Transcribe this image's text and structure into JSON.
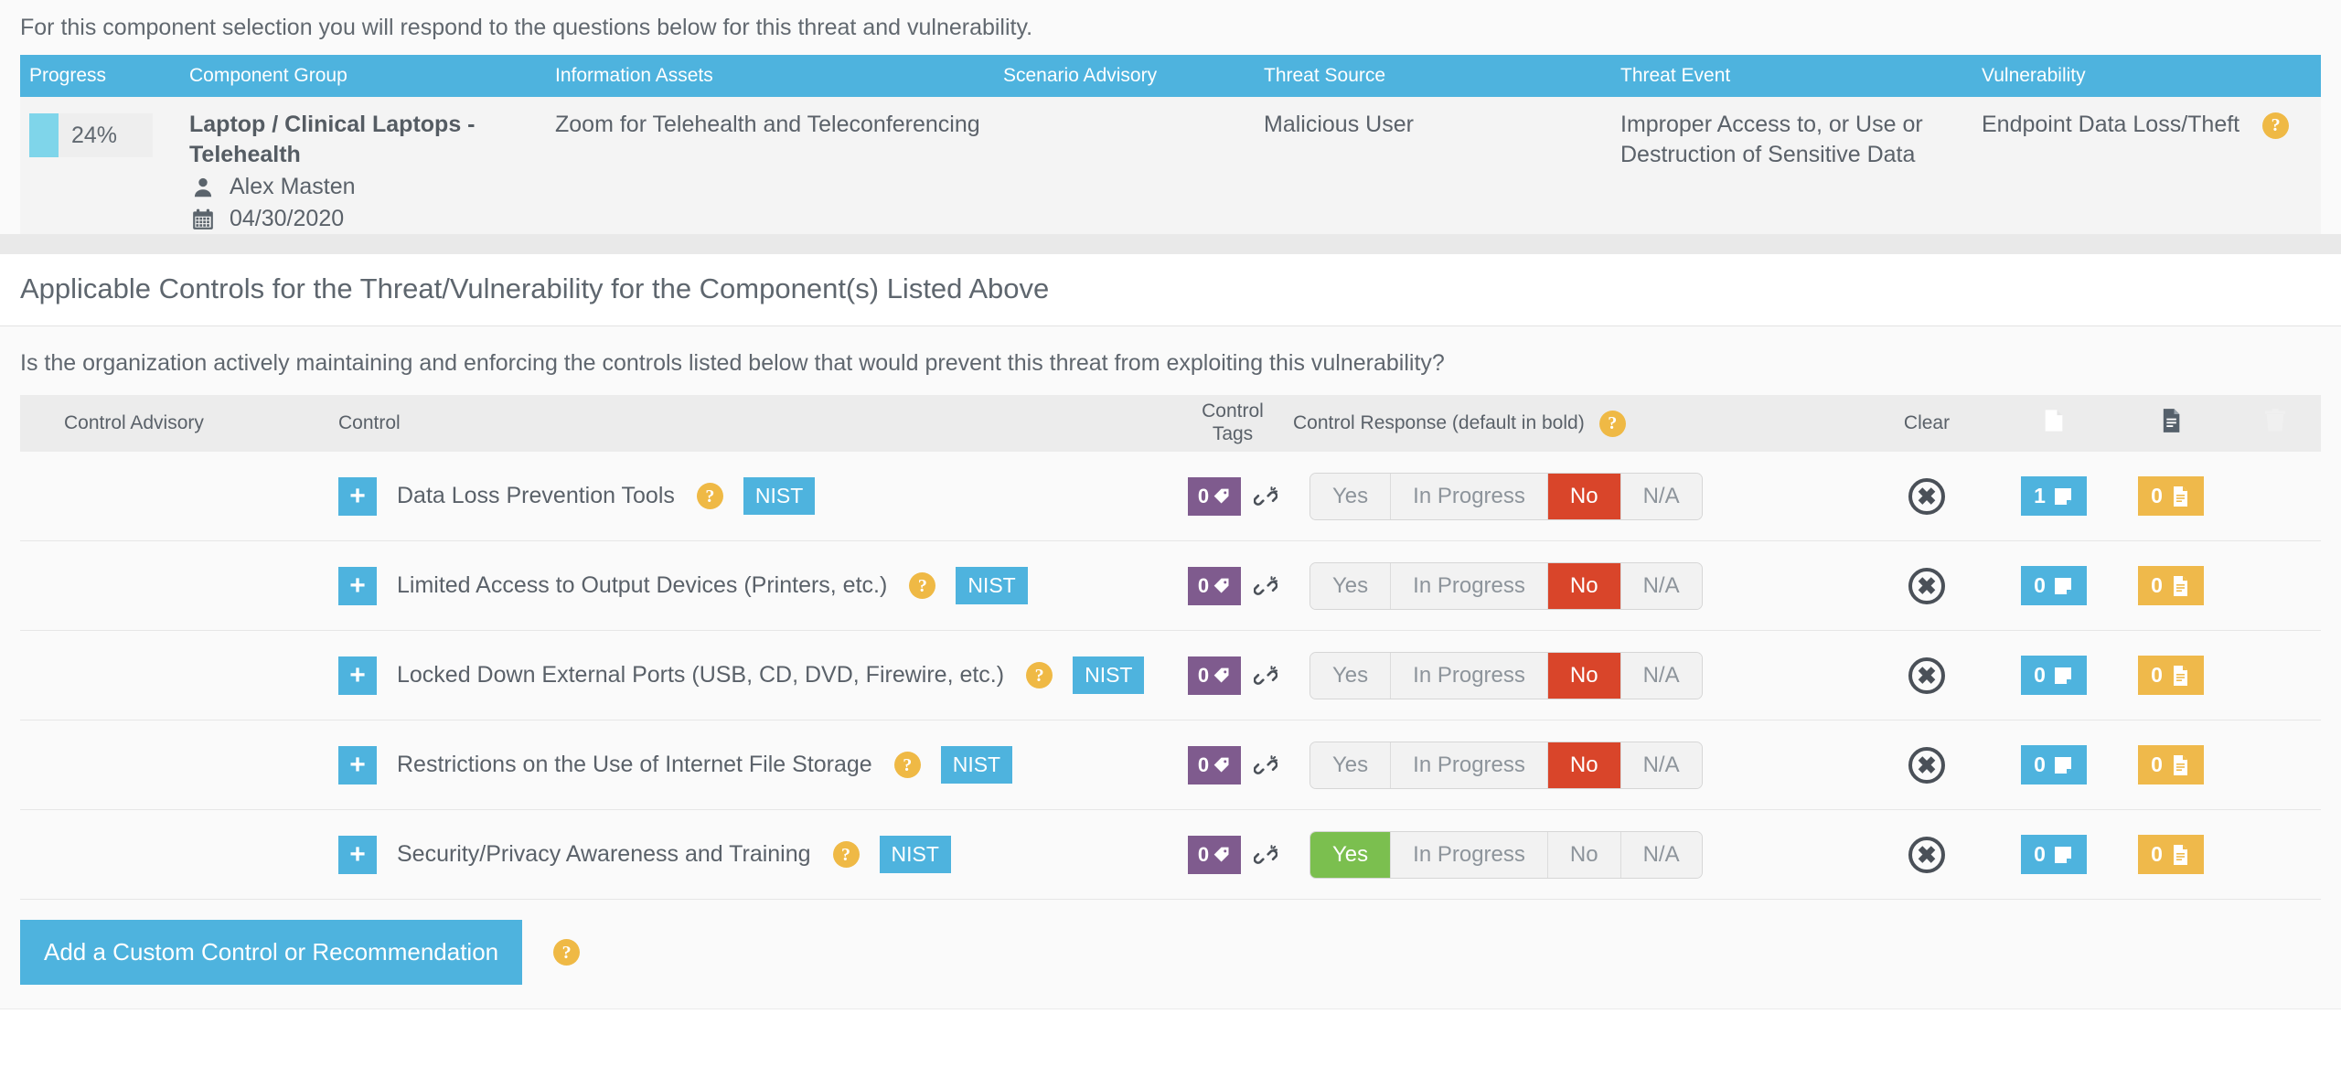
{
  "intro": {
    "text": "For this component selection you will respond to the questions below for this threat and vulnerability."
  },
  "scenario_table": {
    "columns": [
      "Progress",
      "Component Group",
      "Information Assets",
      "Scenario Advisory",
      "Threat Source",
      "Threat Event",
      "Vulnerability"
    ],
    "row": {
      "progress_percent": "24%",
      "progress_value": 24,
      "component_group": "Laptop / Clinical Laptops - Telehealth",
      "owner": "Alex Masten",
      "date": "04/30/2020",
      "information_assets": "Zoom for Telehealth and Teleconferencing",
      "scenario_advisory": "",
      "threat_source": "Malicious User",
      "threat_event": "Improper Access to, or Use or Destruction of Sensitive Data",
      "vulnerability": "Endpoint Data Loss/Theft",
      "vulnerability_help": "?"
    }
  },
  "section": {
    "title": "Applicable Controls for the Threat/Vulnerability for the Component(s) Listed Above",
    "question": "Is the organization actively maintaining and enforcing the controls listed below that would prevent this threat from exploiting this vulnerability?"
  },
  "controls_table": {
    "headers": {
      "control_advisory": "Control Advisory",
      "control": "Control",
      "control_tags_line1": "Control",
      "control_tags_line2": "Tags",
      "control_response": "Control Response (default in bold)",
      "control_response_help": "?",
      "clear": "Clear",
      "note_icon": "note-icon",
      "document_icon": "document-icon",
      "delete_icon": "trash-icon"
    },
    "response_options": [
      "Yes",
      "In Progress",
      "No",
      "N/A"
    ],
    "rows": [
      {
        "expand": "+",
        "name": "Data Loss Prevention Tools",
        "help": "?",
        "framework": "NIST",
        "tag_count": "0",
        "response": "No",
        "note_count": "1",
        "doc_count": "0"
      },
      {
        "expand": "+",
        "name": "Limited Access to Output Devices (Printers, etc.)",
        "help": "?",
        "framework": "NIST",
        "tag_count": "0",
        "response": "No",
        "note_count": "0",
        "doc_count": "0"
      },
      {
        "expand": "+",
        "name": "Locked Down External Ports (USB, CD, DVD, Firewire, etc.)",
        "help": "?",
        "framework": "NIST",
        "tag_count": "0",
        "response": "No",
        "note_count": "0",
        "doc_count": "0"
      },
      {
        "expand": "+",
        "name": "Restrictions on the Use of Internet File Storage",
        "help": "?",
        "framework": "NIST",
        "tag_count": "0",
        "response": "No",
        "note_count": "0",
        "doc_count": "0"
      },
      {
        "expand": "+",
        "name": "Security/Privacy Awareness and Training",
        "help": "?",
        "framework": "NIST",
        "tag_count": "0",
        "response": "Yes",
        "note_count": "0",
        "doc_count": "0"
      }
    ]
  },
  "footer": {
    "add_button": "Add a Custom Control or Recommendation",
    "add_help": "?"
  },
  "colors": {
    "brand_blue": "#4eb3de",
    "progress_fill": "#7fd5ea",
    "help_orange": "#efb945",
    "tag_purple": "#7f5b8e",
    "selected_no": "#d9452a",
    "selected_yes": "#7bbf4f",
    "doc_badge_orange": "#efb94b"
  }
}
